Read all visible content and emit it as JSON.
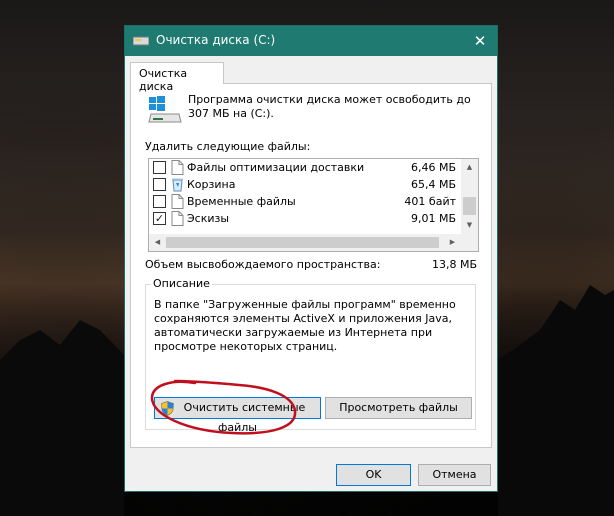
{
  "window": {
    "title": "Очистка диска  (C:)",
    "close_glyph": "✕"
  },
  "tab": {
    "label": "Очистка диска"
  },
  "intro_text": "Программа очистки диска может освободить до 307 МБ на  (C:).",
  "delete_label": "Удалить следующие файлы:",
  "files": [
    {
      "name": "Файлы оптимизации доставки",
      "size": "6,46 МБ",
      "checked": false,
      "icon": "file-icon"
    },
    {
      "name": "Корзина",
      "size": "65,4 МБ",
      "checked": false,
      "icon": "recycle-bin-icon"
    },
    {
      "name": "Временные файлы",
      "size": "401 байт",
      "checked": false,
      "icon": "file-icon"
    },
    {
      "name": "Эскизы",
      "size": "9,01 МБ",
      "checked": true,
      "icon": "file-icon"
    }
  ],
  "space": {
    "label": "Объем высвобождаемого пространства:",
    "value": "13,8 МБ"
  },
  "description": {
    "title": "Описание",
    "text": "В папке \"Загруженные файлы программ\" временно сохраняются элементы ActiveX и приложения Java, автоматически загружаемые из Интернета при просмотре некоторых страниц."
  },
  "buttons": {
    "cleanup_system": "Очистить системные файлы",
    "view_files": "Просмотреть файлы",
    "ok": "OK",
    "cancel": "Отмена"
  },
  "colors": {
    "titlebar": "#1f7b71",
    "annotation": "#c0101e",
    "focus_border": "#0078d7"
  }
}
